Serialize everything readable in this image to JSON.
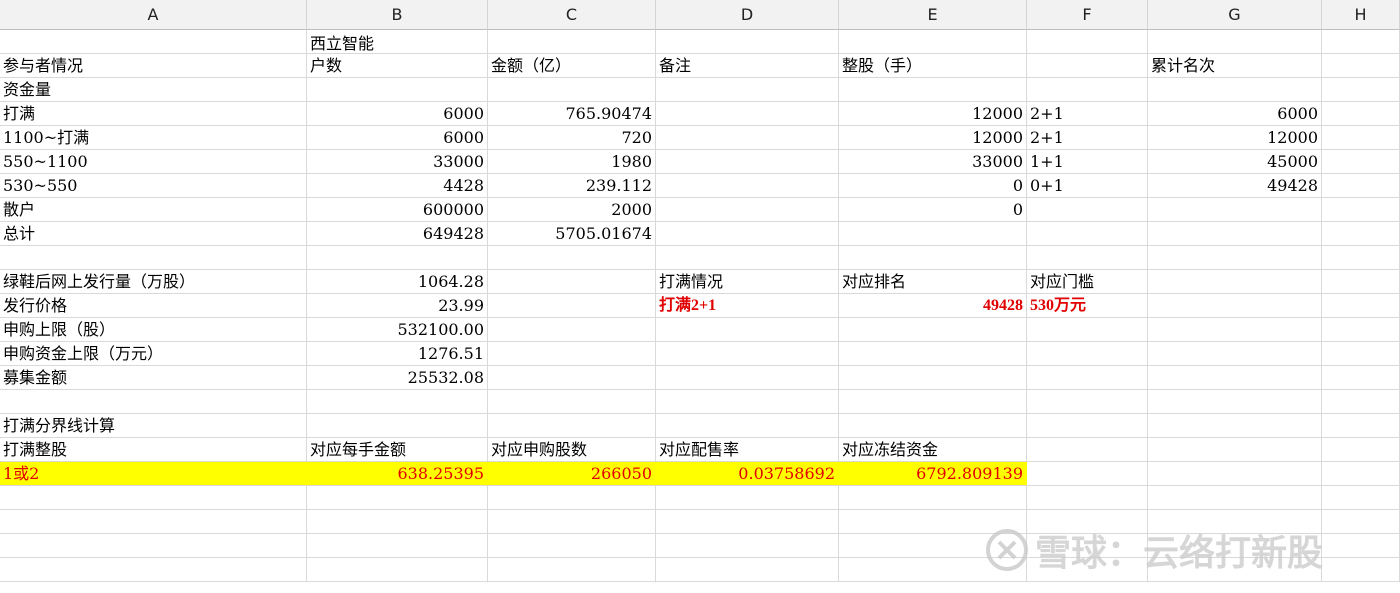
{
  "columns": [
    "A",
    "B",
    "C",
    "D",
    "E",
    "F",
    "G",
    "H"
  ],
  "rows": [
    [
      "",
      "西立智能",
      "",
      "",
      "",
      "",
      "",
      ""
    ],
    [
      "参与者情况",
      "户数",
      "金额（亿）",
      "备注",
      "整股（手）",
      "",
      "累计名次",
      ""
    ],
    [
      "资金量",
      "",
      "",
      "",
      "",
      "",
      "",
      ""
    ],
    [
      "打满",
      "6000",
      "765.90474",
      "",
      "12000",
      "2+1",
      "6000",
      ""
    ],
    [
      "1100~打满",
      "6000",
      "720",
      "",
      "12000",
      "2+1",
      "12000",
      ""
    ],
    [
      "550~1100",
      "33000",
      "1980",
      "",
      "33000",
      "1+1",
      "45000",
      ""
    ],
    [
      "530~550",
      "4428",
      "239.112",
      "",
      "0",
      "0+1",
      "49428",
      ""
    ],
    [
      "散户",
      "600000",
      "2000",
      "",
      "0",
      "",
      "",
      ""
    ],
    [
      "总计",
      "649428",
      "5705.01674",
      "",
      "",
      "",
      "",
      ""
    ],
    [
      "",
      "",
      "",
      "",
      "",
      "",
      "",
      ""
    ],
    [
      "绿鞋后网上发行量（万股）",
      "1064.28",
      "",
      "打满情况",
      "对应排名",
      "对应门槛",
      "",
      ""
    ],
    [
      "发行价格",
      "23.99",
      "",
      "打满2+1",
      "49428",
      "530万元",
      "",
      ""
    ],
    [
      "申购上限（股）",
      "532100.00",
      "",
      "",
      "",
      "",
      "",
      ""
    ],
    [
      "申购资金上限（万元）",
      "1276.51",
      "",
      "",
      "",
      "",
      "",
      ""
    ],
    [
      "募集金额",
      "25532.08",
      "",
      "",
      "",
      "",
      "",
      ""
    ],
    [
      "",
      "",
      "",
      "",
      "",
      "",
      "",
      ""
    ],
    [
      "打满分界线计算",
      "",
      "",
      "",
      "",
      "",
      "",
      ""
    ],
    [
      "打满整股",
      "对应每手金额",
      "对应申购股数",
      "对应配售率",
      "对应冻结资金",
      "",
      "",
      ""
    ],
    [
      "1或2",
      "638.25395",
      "266050",
      "0.03758692",
      "6792.809139",
      "",
      "",
      ""
    ],
    [
      "",
      "",
      "",
      "",
      "",
      "",
      "",
      ""
    ],
    [
      "",
      "",
      "",
      "",
      "",
      "",
      "",
      ""
    ],
    [
      "",
      "",
      "",
      "",
      "",
      "",
      "",
      ""
    ],
    [
      "",
      "",
      "",
      "",
      "",
      "",
      "",
      ""
    ]
  ],
  "watermark": {
    "text": "雪球：云络打新股",
    "icon": "snowball-logo-icon"
  },
  "colors": {
    "highlight": "#ffff00",
    "red_text": "#e00000",
    "header_bg": "#f2f2f2"
  }
}
